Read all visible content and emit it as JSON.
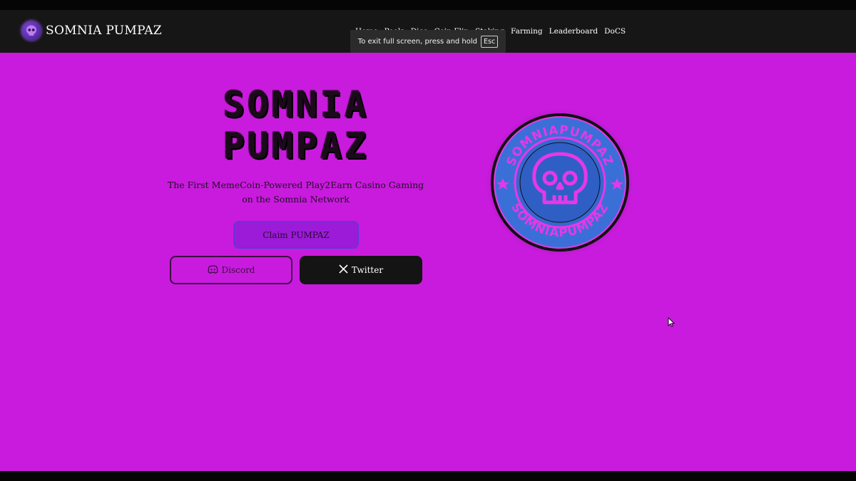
{
  "navbar": {
    "brand": "SOMNIA PUMPAZ",
    "links": [
      "Home",
      "Pools",
      "Dice",
      "Coin Flip",
      "Staking",
      "Farming",
      "Leaderboard",
      "DoCS"
    ]
  },
  "fullscreen_toast": {
    "text": "To exit full screen, press and hold",
    "key": "Esc"
  },
  "hero": {
    "title_line1": "SOMNIA",
    "title_line2": "PUMPAZ",
    "tagline_line1": "The First MemeCoin-Powered Play2Earn Casino Gaming",
    "tagline_line2": "on the Somnia Network",
    "claim_label": "Claim PUMPAZ",
    "discord_label": "Discord",
    "twitter_label": "Twitter",
    "coin_text_top": "SOMNIAPUMPAZ",
    "coin_text_bottom": "SOMNIAPUMPAZ"
  },
  "colors": {
    "hero_bg": "#c91bdd",
    "navbar_bg": "#161616",
    "coin_blue": "#3b6fd8",
    "coin_pink": "#e638e8"
  },
  "icons": [
    "skull-logo-icon",
    "discord-icon",
    "x-icon",
    "skull-icon",
    "star-icon",
    "mouse-cursor-icon"
  ]
}
